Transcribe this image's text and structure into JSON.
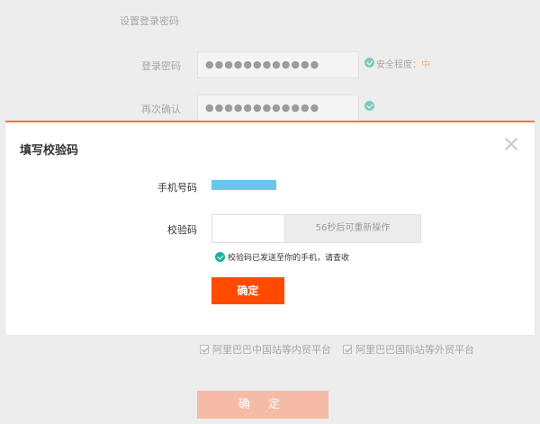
{
  "background_form": {
    "section_title": "设置登录密码",
    "password_label": "登录密码",
    "password_value": "●●●●●●●●●●●●",
    "strength_label": "安全程度：",
    "strength_level": "中",
    "confirm_label": "再次确认",
    "confirm_value": "●●●●●●●●●●●●",
    "agreements": [
      {
        "label": "阿里巴巴中国站等内贸平台",
        "checked": true
      },
      {
        "label": "阿里巴巴国际站等外贸平台",
        "checked": true
      }
    ],
    "submit_label": "确 定"
  },
  "modal": {
    "title": "填写校验码",
    "phone_label": "手机号码",
    "code_label": "校验码",
    "code_placeholder": "",
    "resend_label": "56秒后可重新操作",
    "sent_message": "校验码已发送至你的手机，请查收",
    "confirm_label": "确定"
  },
  "colors": {
    "accent": "#ff4a00",
    "modal_top_border": "#f07b40",
    "success": "#17b3a0",
    "phone_mask": "#6ac5ec"
  }
}
